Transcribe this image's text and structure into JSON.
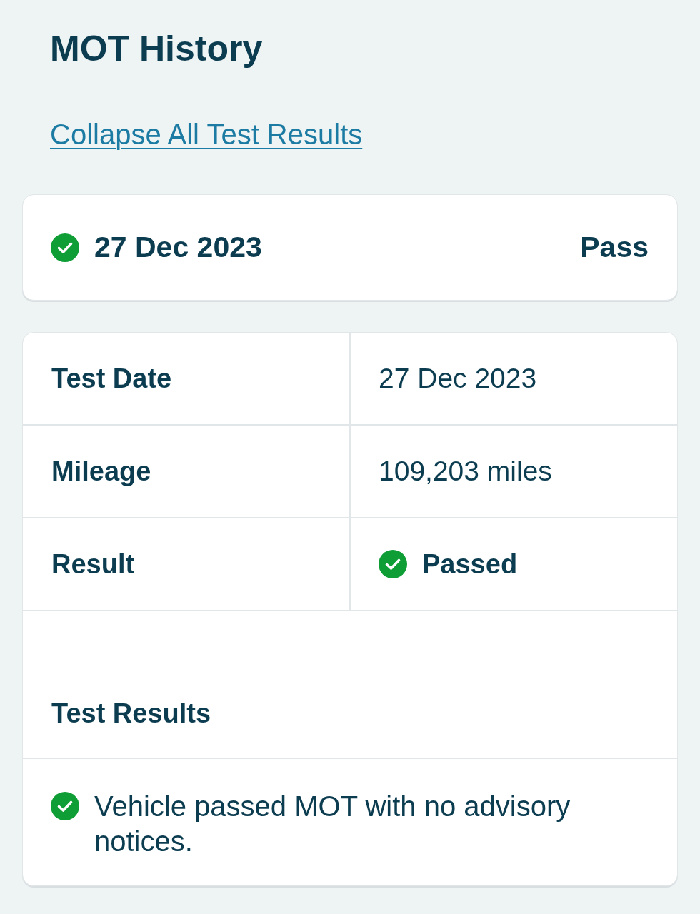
{
  "title": "MOT History",
  "collapse_link": "Collapse All Test Results",
  "tests": [
    {
      "date": "27 Dec 2023",
      "status": "Pass",
      "kind": "pass",
      "expanded": true,
      "details": [
        {
          "label": "Test Date",
          "value": "27 Dec 2023",
          "kind": "text"
        },
        {
          "label": "Mileage",
          "value": "109,203 miles",
          "kind": "text"
        },
        {
          "label": "Result",
          "value": "Passed",
          "kind": "pass"
        }
      ],
      "results_heading": "Test Results",
      "results": [
        {
          "text": "Vehicle passed MOT with no advisory notices.",
          "kind": "pass"
        }
      ]
    }
  ]
}
